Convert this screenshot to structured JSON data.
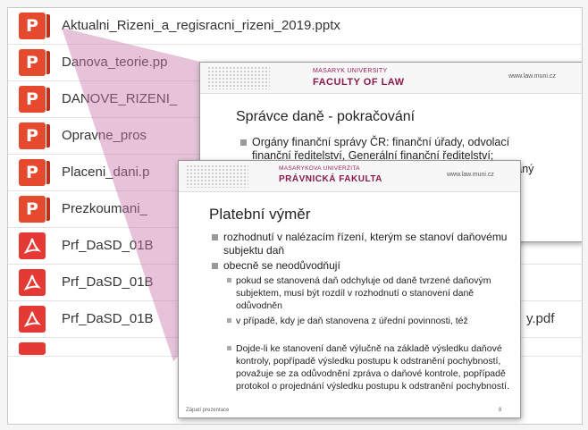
{
  "files": [
    {
      "name": "Aktualni_Rizeni_a_regisracni_rizeni_2019.pptx",
      "icon": "powerpoint-icon",
      "icon_letter": "P"
    },
    {
      "name": "Danova_teorie.pp",
      "icon": "powerpoint-icon",
      "icon_letter": "P"
    },
    {
      "name": "DANOVE_RIZENI_",
      "icon": "powerpoint-icon",
      "icon_letter": "P"
    },
    {
      "name": "Opravne_pros",
      "icon": "powerpoint-icon",
      "icon_letter": "P"
    },
    {
      "name": "Placeni_dani.p",
      "icon": "powerpoint-icon",
      "icon_letter": "P"
    },
    {
      "name": "Prezkoumani_",
      "icon": "powerpoint-icon",
      "icon_letter": "P"
    },
    {
      "name": "Prf_DaSD_01B",
      "icon": "pdf-icon"
    },
    {
      "name": "Prf_DaSD_01B",
      "icon": "pdf-icon"
    },
    {
      "name": "Prf_DaSD_01B",
      "icon": "pdf-icon",
      "suffix": "y.pdf"
    }
  ],
  "back_slide": {
    "university": "MASARYK UNIVERSITY",
    "faculty": "FACULTY OF LAW",
    "url": "www.law.muni.cz",
    "title": "Správce daně - pokračování",
    "bullet_line1": "Orgány finanční správy ČR: finanční úřady, odvolací",
    "bullet_line2": "finanční ředitelství, Generální finanční ředitelství;",
    "bullet_line3": "vaný"
  },
  "front_slide": {
    "university": "MASARYKOVA UNIVERZITA",
    "faculty": "PRÁVNICKÁ FAKULTA",
    "url": "www.law.muni.cz",
    "title": "Platební výměr",
    "bullets": [
      "rozhodnutí v nalézacím řízení, kterým se stanoví daňovému subjektu daň",
      "obecně se neodůvodňují"
    ],
    "sub_bullets": [
      "pokud se stanovená daň odchyluje od daně tvrzené daňovým subjektem, musí být rozdíl v rozhodnutí o stanovení daně odůvodněn",
      "v případě, kdy je daň stanovena z úřední povinnosti, též",
      "Dojde-li ke stanovení daně výlučně na základě výsledku daňové kontroly, popřípadě výsledku postupu k odstranění pochybností, považuje se za odůvodnění zpráva o daňové kontrole, popřípadě protokol o projednání výsledku postupu k odstranění pochybností."
    ],
    "footer": "Zápatí prezentace",
    "page": "8"
  },
  "colors": {
    "ppt": "#e64a2e",
    "pdf": "#e53935",
    "accent": "#8a1a4d",
    "wedge": "#c77aa8"
  }
}
